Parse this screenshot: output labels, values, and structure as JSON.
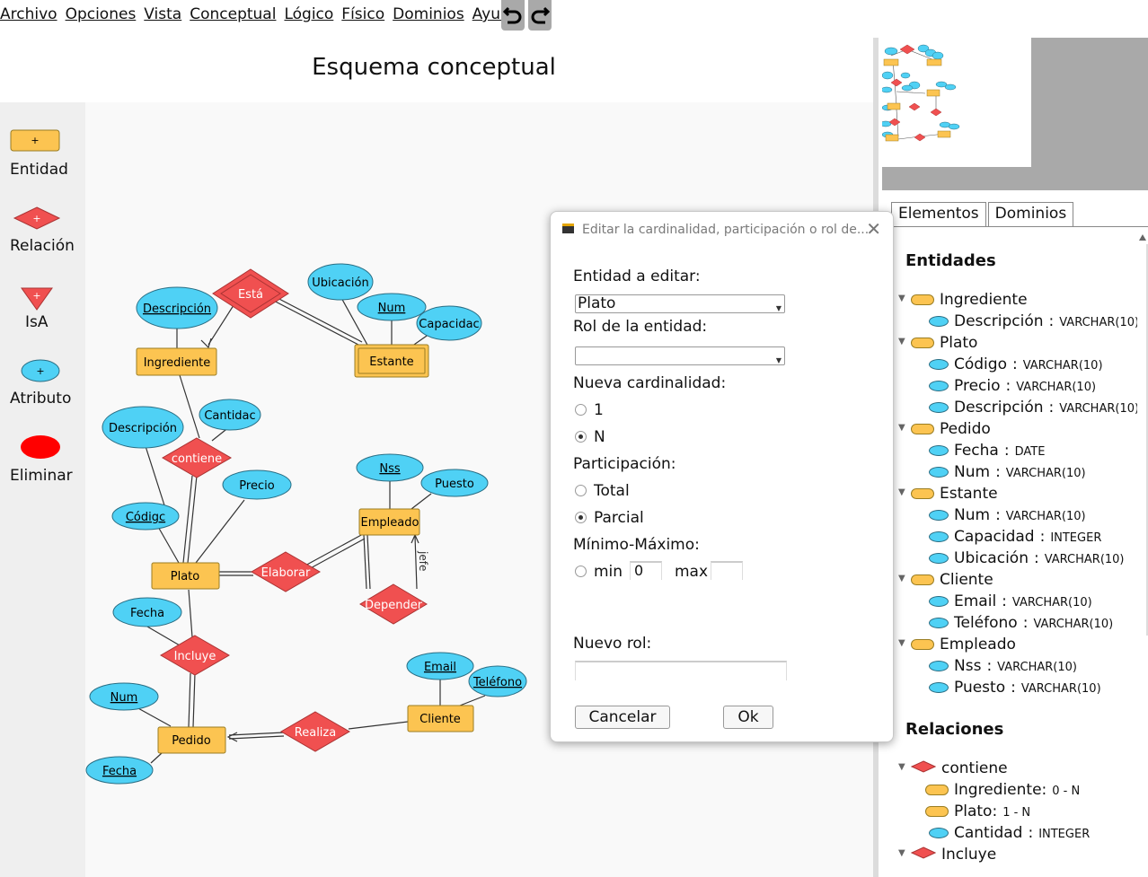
{
  "menu": [
    "Archivo",
    "Opciones",
    "Vista",
    "Conceptual",
    "Lógico",
    "Físico",
    "Dominios",
    "Ayuda"
  ],
  "toolbar": {
    "undo_icon": "undo-arrow-icon",
    "redo_icon": "redo-arrow-icon"
  },
  "title": "Esquema conceptual",
  "palette": {
    "plus": "+",
    "entity": "Entidad",
    "relation": "Relación",
    "isa": "IsA",
    "attribute": "Atributo",
    "delete": "Eliminar"
  },
  "diagram": {
    "entities": {
      "ingrediente": "Ingrediente",
      "estante": "Estante",
      "empleado": "Empleado",
      "plato": "Plato",
      "pedido": "Pedido",
      "cliente": "Cliente"
    },
    "relations": {
      "esta": "Está",
      "contiene": "contiene",
      "elaborar": "Elaborar",
      "depender": "Depender",
      "incluye": "Incluye",
      "realiza": "Realiza"
    },
    "attributes": {
      "ing_descripcion": "Descripción",
      "est_ubicacion": "Ubicación",
      "est_num": "Num",
      "est_capacidad": "Capacidac",
      "pla_descripcion": "Descripción",
      "cont_cantidad": "Cantidac",
      "emp_nss": "Nss",
      "emp_puesto": "Puesto",
      "pla_precio": "Precio",
      "pla_codigo": "Códigc",
      "ped_fecha_top": "Fecha",
      "cli_email": "Email",
      "cli_telefono": "Teléfono",
      "ped_num": "Num",
      "ped_fecha": "Fecha"
    },
    "role_jefe": "jefe"
  },
  "tabs": [
    "Elementos",
    "Dominios"
  ],
  "tree": {
    "entities_header": "Entidades",
    "relations_header": "Relaciones",
    "rows": [
      {
        "kind": "entity",
        "label": "Ingrediente"
      },
      {
        "kind": "attr",
        "label": "Descripción",
        "type": "VARCHAR(10)"
      },
      {
        "kind": "entity",
        "label": "Plato"
      },
      {
        "kind": "attr",
        "label": "Código",
        "type": "VARCHAR(10)"
      },
      {
        "kind": "attr",
        "label": "Precio",
        "type": "VARCHAR(10)"
      },
      {
        "kind": "attr",
        "label": "Descripción",
        "type": "VARCHAR(10)"
      },
      {
        "kind": "entity",
        "label": "Pedido"
      },
      {
        "kind": "attr",
        "label": "Fecha",
        "type": "DATE"
      },
      {
        "kind": "attr",
        "label": "Num",
        "type": "VARCHAR(10)"
      },
      {
        "kind": "entity",
        "label": "Estante"
      },
      {
        "kind": "attr",
        "label": "Num",
        "type": "VARCHAR(10)"
      },
      {
        "kind": "attr",
        "label": "Capacidad",
        "type": "INTEGER"
      },
      {
        "kind": "attr",
        "label": "Ubicación",
        "type": "VARCHAR(10)"
      },
      {
        "kind": "entity",
        "label": "Cliente"
      },
      {
        "kind": "attr",
        "label": "Email",
        "type": "VARCHAR(10)"
      },
      {
        "kind": "attr",
        "label": "Teléfono",
        "type": "VARCHAR(10)"
      },
      {
        "kind": "entity",
        "label": "Empleado"
      },
      {
        "kind": "attr",
        "label": "Nss",
        "type": "VARCHAR(10)"
      },
      {
        "kind": "attr",
        "label": "Puesto",
        "type": "VARCHAR(10)"
      }
    ],
    "rel_rows": [
      {
        "kind": "relation",
        "label": "contiene"
      },
      {
        "kind": "part",
        "label": "Ingrediente:",
        "type": "0 - N"
      },
      {
        "kind": "part",
        "label": "Plato:",
        "type": "1 - N"
      },
      {
        "kind": "relattr",
        "label": "Cantidad",
        "type": "INTEGER"
      },
      {
        "kind": "relation",
        "label": "Incluye"
      }
    ],
    "sep": ":"
  },
  "dialog": {
    "title": "Editar la cardinalidad, participación o rol de...",
    "close": "✕",
    "entity_label": "Entidad a editar:",
    "entity_value": "Plato",
    "role_label": "Rol de la entidad:",
    "role_value": "",
    "card_label": "Nueva cardinalidad:",
    "card_opts": [
      "1",
      "N"
    ],
    "card_selected": "N",
    "part_label": "Participación:",
    "part_opts": [
      "Total",
      "Parcial"
    ],
    "part_selected": "Parcial",
    "minmax_label": "Mínimo-Máximo:",
    "min_label": "min",
    "min_value": "0",
    "max_label": "max",
    "max_value": "",
    "newrole_label": "Nuevo rol:",
    "newrole_value": "",
    "cancel": "Cancelar",
    "ok": "Ok"
  },
  "colors": {
    "entity_fill": "#fcc451",
    "attribute_fill": "#4fd1f5",
    "relation_fill": "#f05050",
    "delete_red": "#ff0000",
    "palette_bg": "#efefef",
    "canvas_bg": "#f9f9f9"
  }
}
